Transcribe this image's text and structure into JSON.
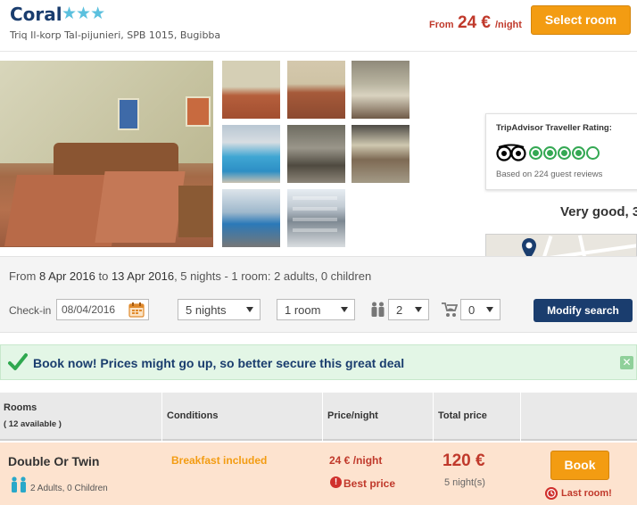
{
  "hotel": {
    "name": "Coral",
    "stars": "★★★",
    "address": "Triq Il-korp Tal-pijunieri, SPB 1015, Bugibba",
    "from_label": "From",
    "from_price": "24 €",
    "per_night": "/night",
    "select_room_label": "Select room"
  },
  "tripadvisor": {
    "title": "TripAdvisor Traveller Rating:",
    "rating_circles": 4,
    "rating_max": 5,
    "reviews": "Based on 224 guest reviews",
    "verdict": "Very good, 3"
  },
  "map": {
    "label": "map"
  },
  "search": {
    "summary": {
      "from_word": "From",
      "from_date": "8 Apr 2016",
      "to_word": "to",
      "to_date": "13 Apr 2016",
      "details": ", 5 nights - 1 room: 2 adults, 0 children"
    },
    "checkin_label": "Check-in",
    "checkin_value": "08/04/2016",
    "nights": "5 nights",
    "rooms": "1 room",
    "adults": "2",
    "children": "0",
    "modify_label": "Modify search"
  },
  "alert": {
    "text": "Book now! Prices might go up, so better secure this great deal",
    "close": "✕"
  },
  "table": {
    "headers": {
      "rooms": "Rooms",
      "available": "( 12 available )",
      "conditions": "Conditions",
      "price_night": "Price/night",
      "total_price": "Total price"
    },
    "rows": [
      {
        "room": "Double Or Twin",
        "guests": "2 Adults, 0 Children",
        "condition": "Breakfast included",
        "night_price": "24 € /night",
        "badge_icon": "!",
        "badge": "Best price",
        "total": "120 €",
        "nights": "5 night(s)",
        "book_label": "Book",
        "last_room": "Last room!"
      }
    ]
  },
  "colors": {
    "brand_navy": "#1a3d6e",
    "accent_orange": "#f39c12",
    "price_red": "#c0392b",
    "rating_green": "#34a853",
    "alert_bg": "#e3f6e6",
    "row_highlight": "#fde3cf"
  },
  "icons": [
    "star-icon",
    "tripadvisor-owl-icon",
    "map-pin-icon",
    "calendar-icon",
    "adults-icon",
    "stroller-icon",
    "check-icon",
    "close-icon",
    "guests-icon",
    "alert-icon",
    "clock-icon"
  ]
}
